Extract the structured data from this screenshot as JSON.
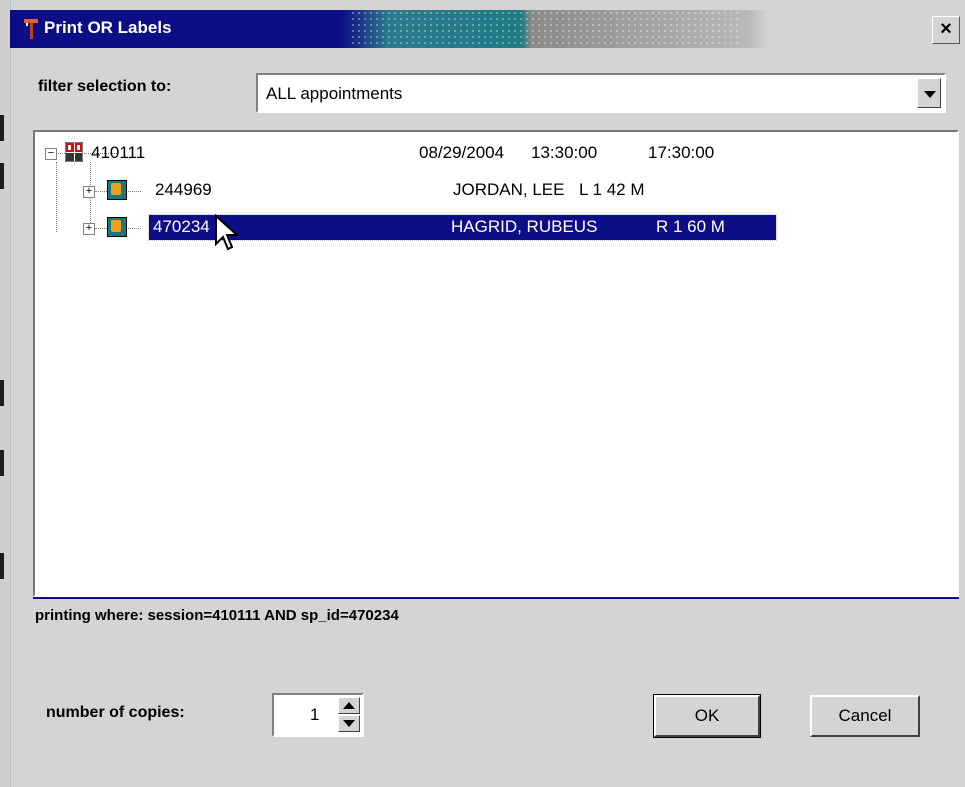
{
  "window": {
    "title": "Print OR Labels",
    "close_label": "×"
  },
  "filter": {
    "label": "filter selection to:",
    "value": "ALL appointments"
  },
  "tree": {
    "root": {
      "id": "410111",
      "date": "08/29/2004",
      "start": "13:30:00",
      "end": "17:30:00",
      "expander": "−"
    },
    "children": [
      {
        "id": "244969",
        "name": "JORDAN, LEE",
        "details": "L 1 42 M",
        "expander": "+"
      },
      {
        "id": "470234",
        "name": "HAGRID, RUBEUS",
        "details": "R 1 60 M",
        "expander": "+"
      }
    ],
    "selected_id": "470234"
  },
  "status": {
    "text": "printing where: session=410111 AND sp_id=470234"
  },
  "copies": {
    "label": "number of copies:",
    "value": "1"
  },
  "buttons": {
    "ok": "OK",
    "cancel": "Cancel"
  },
  "colors": {
    "selection": "#0d0d86",
    "title_bar": "#0d0d86",
    "background": "#d4d4d4"
  },
  "icons": {
    "app": "print-labels-icon",
    "root_node": "schedule-grid-icon",
    "child_node": "specimen-jar-icon"
  }
}
